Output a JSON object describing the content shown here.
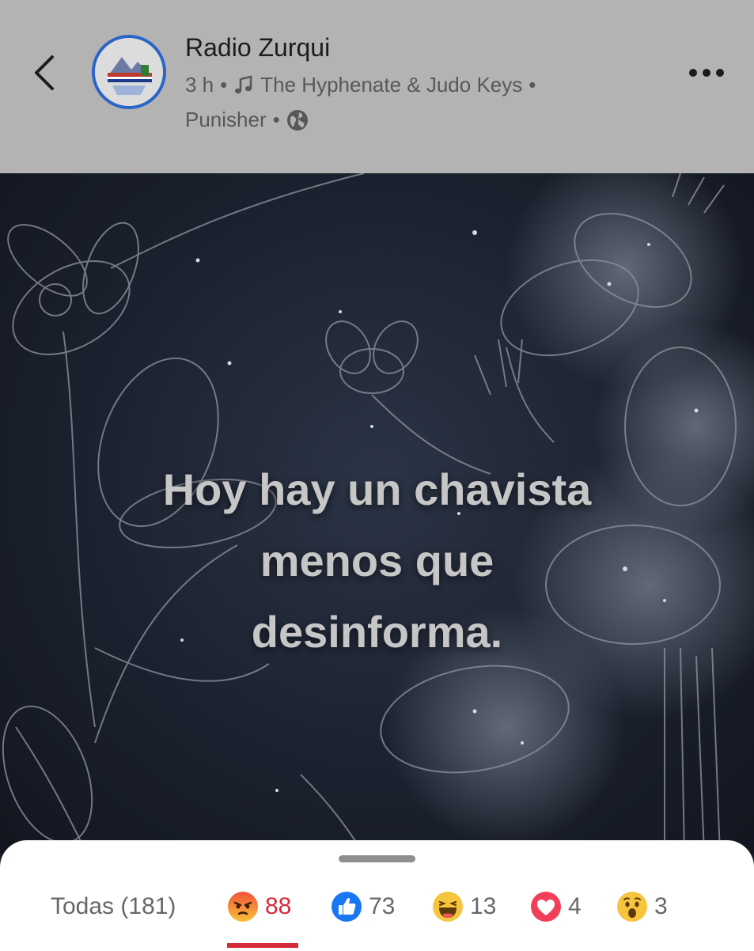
{
  "header": {
    "page_name": "Radio Zurqui",
    "time": "3 h",
    "separator": "•",
    "song_line1": "The Hyphenate & Judo Keys",
    "song_line2": "Punisher",
    "privacy_icon": "globe-icon",
    "back_icon": "chevron-left-icon",
    "more_icon": "more-horizontal-icon",
    "avatar_label": "Radio Zurqui"
  },
  "post": {
    "quote_line1": "Hoy hay un chavista",
    "quote_line2": "menos que",
    "quote_line3": "desinforma."
  },
  "reactions": {
    "all_label": "Todas (181)",
    "tabs": [
      {
        "icon": "angry-reaction-icon",
        "count": "88",
        "active": true
      },
      {
        "icon": "like-reaction-icon",
        "count": "73"
      },
      {
        "icon": "haha-reaction-icon",
        "count": "13"
      },
      {
        "icon": "love-reaction-icon",
        "count": "4"
      },
      {
        "icon": "wow-reaction-icon",
        "count": "3"
      }
    ]
  },
  "colors": {
    "header_bg": "#b3b3b3",
    "active_tab": "#d52b3b",
    "avatar_ring": "#2a63c9"
  }
}
